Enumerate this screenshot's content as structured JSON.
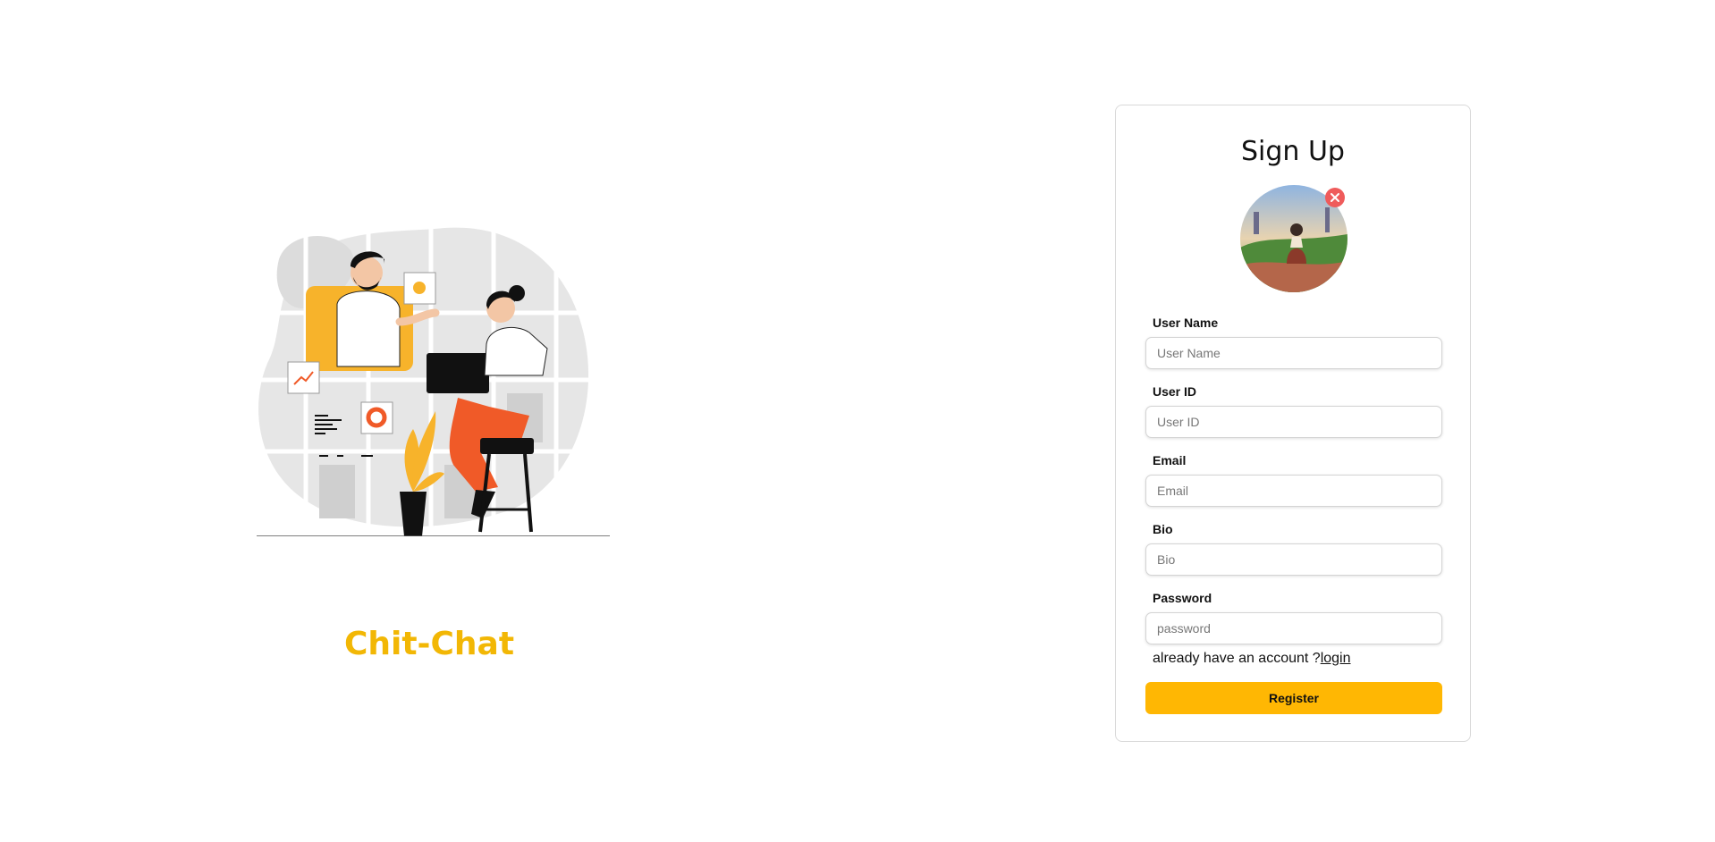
{
  "brand": {
    "title": "Chit-Chat",
    "color": "#f2b705"
  },
  "illustration": {
    "icon": "team-chat-illustration"
  },
  "signup": {
    "title": "Sign Up",
    "avatar_icon": "profile-photo",
    "remove_avatar_icon": "close-circle-icon",
    "fields": [
      {
        "label": "User Name",
        "placeholder": "User Name",
        "value": ""
      },
      {
        "label": "User ID",
        "placeholder": "User ID",
        "value": ""
      },
      {
        "label": "Email",
        "placeholder": "Email",
        "value": ""
      },
      {
        "label": "Bio",
        "placeholder": "Bio",
        "value": ""
      },
      {
        "label": "Password",
        "placeholder": "password",
        "value": ""
      }
    ],
    "login_prompt": "already have an account ?",
    "login_link": "login",
    "register_label": "Register",
    "accent_color": "#ffb703",
    "remove_color": "#ef5b5b"
  }
}
